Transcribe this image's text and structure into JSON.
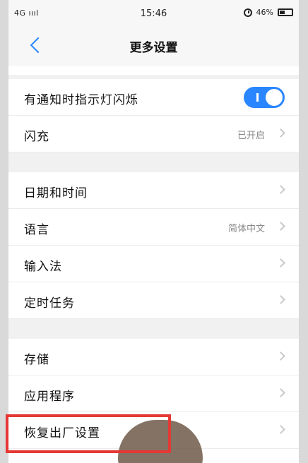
{
  "status": {
    "network": "4G",
    "time": "15:46",
    "battery": "46%",
    "icons": [
      "signal-icon",
      "alarm-icon",
      "battery-icon"
    ]
  },
  "header": {
    "title": "更多设置"
  },
  "rows": [
    {
      "label": "有通知时指示灯闪烁",
      "toggle_on": true
    },
    {
      "label": "闪充",
      "value": "已开启"
    },
    {
      "label": "日期和时间"
    },
    {
      "label": "语言",
      "value": "简体中文"
    },
    {
      "label": "输入法"
    },
    {
      "label": "定时任务"
    },
    {
      "label": "存储"
    },
    {
      "label": "应用程序"
    },
    {
      "label": "恢复出厂设置"
    }
  ],
  "colors": {
    "accent": "#2a86ff",
    "highlight": "#e53935"
  }
}
